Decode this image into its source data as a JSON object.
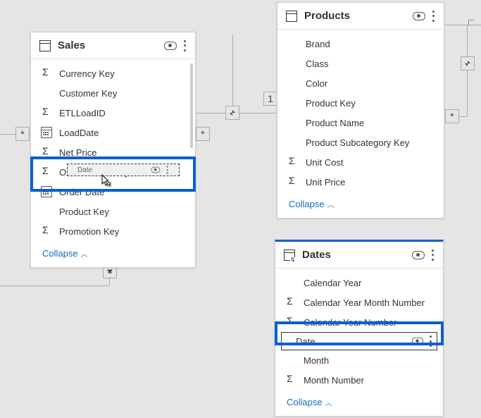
{
  "tables": {
    "sales": {
      "title": "Sales",
      "fields": [
        {
          "icon": "sigma",
          "label": "Currency Key"
        },
        {
          "icon": "",
          "label": "Customer Key"
        },
        {
          "icon": "sigma",
          "label": "ETLLoadID"
        },
        {
          "icon": "cal",
          "label": "LoadDate"
        },
        {
          "icon": "sigma",
          "label": "Net Price"
        },
        {
          "icon": "sigma",
          "label": "Online Sales Key"
        },
        {
          "icon": "cal",
          "label": "Order Date"
        },
        {
          "icon": "",
          "label": "Product Key"
        },
        {
          "icon": "sigma",
          "label": "Promotion Key"
        }
      ],
      "collapse": "Collapse"
    },
    "products": {
      "title": "Products",
      "fields": [
        {
          "icon": "",
          "label": "Brand"
        },
        {
          "icon": "",
          "label": "Class"
        },
        {
          "icon": "",
          "label": "Color"
        },
        {
          "icon": "",
          "label": "Product Key"
        },
        {
          "icon": "",
          "label": "Product Name"
        },
        {
          "icon": "",
          "label": "Product Subcategory Key"
        },
        {
          "icon": "sigma",
          "label": "Unit Cost"
        },
        {
          "icon": "sigma",
          "label": "Unit Price"
        }
      ],
      "collapse": "Collapse"
    },
    "dates": {
      "title": "Dates",
      "fields": [
        {
          "icon": "",
          "label": "Calendar Year"
        },
        {
          "icon": "sigma",
          "label": "Calendar Year Month Number"
        },
        {
          "icon": "sigma",
          "label": "Calendar Year Number"
        },
        {
          "icon": "",
          "label": "Date",
          "selected": true
        },
        {
          "icon": "",
          "label": "Month"
        },
        {
          "icon": "sigma",
          "label": "Month Number"
        }
      ],
      "collapse": "Collapse"
    }
  },
  "relationship": {
    "one": "1",
    "many": "*"
  },
  "drag": {
    "ghost_label": "Date"
  }
}
